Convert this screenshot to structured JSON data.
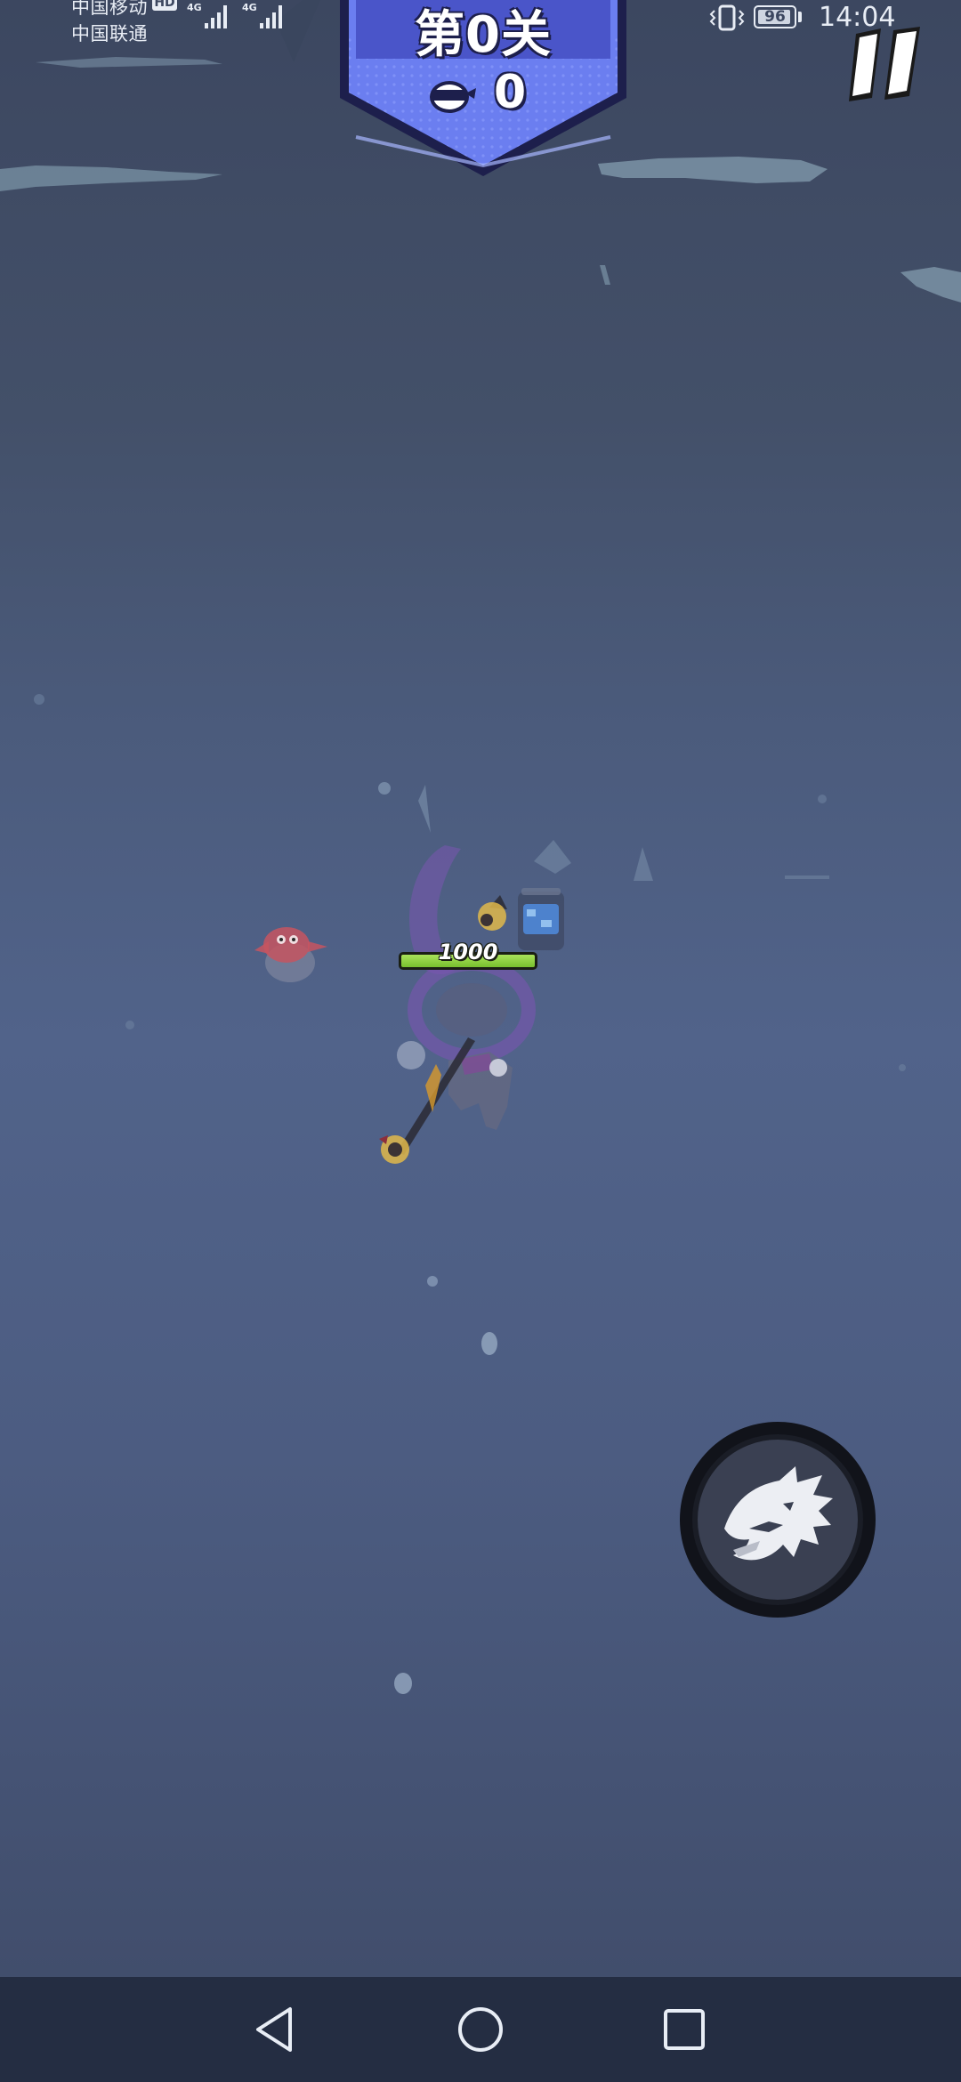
{
  "status_bar": {
    "carrier_1": "中国移动",
    "carrier_1_badge": "HD",
    "carrier_2": "中国联通",
    "network_1": "4G",
    "network_2": "4G",
    "battery_percent": 96,
    "battery_label": "96",
    "time": "14:04"
  },
  "hud": {
    "level_title": "第0关",
    "kill_count": "0",
    "pause_icon": "pause-icon"
  },
  "player": {
    "health_value": "1000",
    "health_fraction": 1.0
  },
  "skill": {
    "icon": "dragon-head-icon"
  },
  "nav_bar": {
    "back_icon": "back-triangle-icon",
    "home_icon": "home-circle-icon",
    "recent_icon": "recent-square-icon"
  },
  "colors": {
    "banner_fill": "#6b7ef0",
    "banner_dark": "#1d1f4c",
    "health_green": "#8cd43e",
    "background": "#4b5b7c",
    "nav_bar": "#242d42"
  }
}
